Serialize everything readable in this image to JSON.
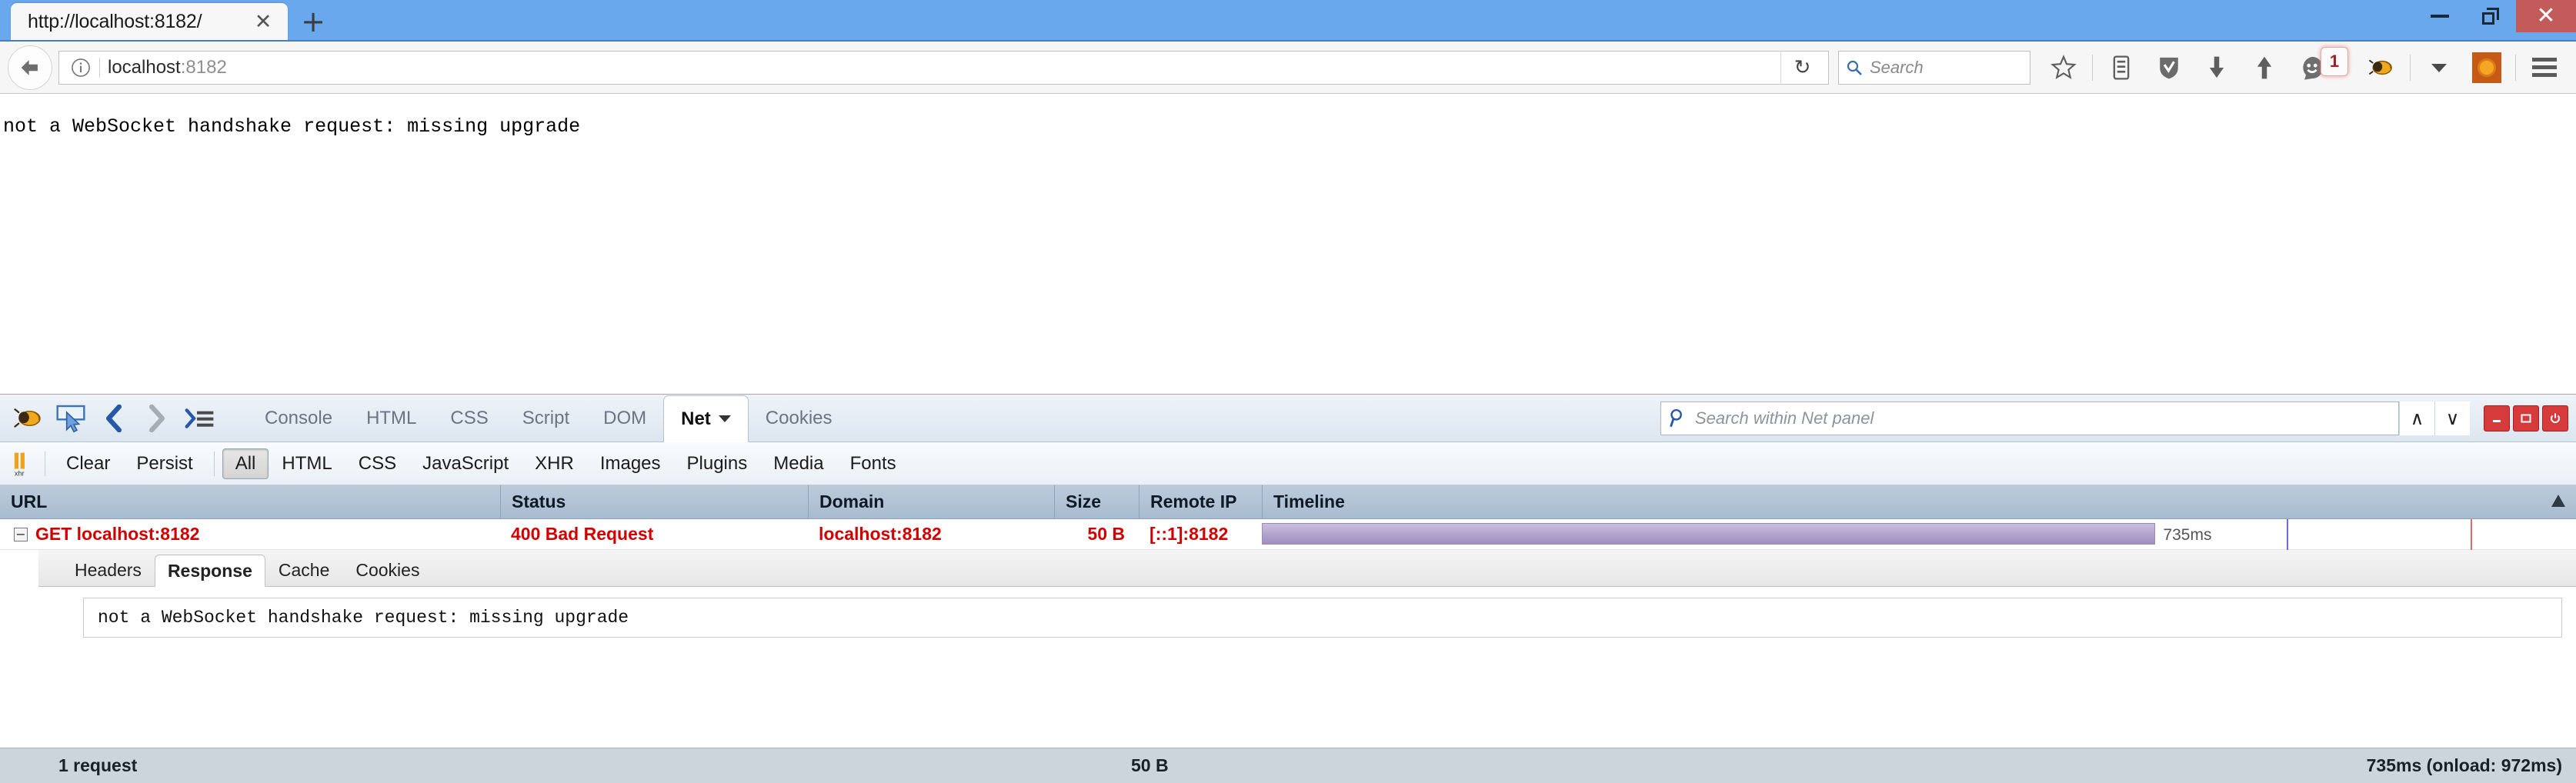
{
  "browser": {
    "tab": {
      "title": "http://localhost:8182/",
      "close_label": "✕"
    },
    "newtab_label": "+",
    "window_controls": {
      "minimize": "minimize-icon",
      "restore": "restore-icon",
      "close": "✕"
    },
    "nav": {
      "back_label": "←",
      "info_label": "i",
      "url_host": "localhost",
      "url_port": ":8182",
      "reload_label": "↻",
      "search_placeholder": "Search"
    },
    "toolbar_icons": [
      {
        "name": "bookmark-star-icon",
        "glyph": "☆"
      },
      {
        "name": "reader-list-icon",
        "glyph": "☰"
      },
      {
        "name": "shield-icon",
        "glyph": "✔"
      },
      {
        "name": "download-icon",
        "glyph": "↓"
      },
      {
        "name": "home-up-icon",
        "glyph": "↑"
      },
      {
        "name": "smiley-feedback-icon",
        "glyph": "☺"
      },
      {
        "name": "firebug-icon",
        "glyph": "🐞"
      },
      {
        "name": "dropdown-caret-icon",
        "glyph": "▾"
      },
      {
        "name": "addon-orange-icon",
        "glyph": "☀"
      },
      {
        "name": "menu-hamburger-icon",
        "glyph": "☰"
      }
    ],
    "notification_badge": "1"
  },
  "page": {
    "body_text": "not a WebSocket handshake request: missing upgrade"
  },
  "firebug": {
    "toolbar_icons": [
      {
        "name": "firebug-bug-icon"
      },
      {
        "name": "inspector-icon"
      },
      {
        "name": "back-chevron-icon",
        "glyph": "‹"
      },
      {
        "name": "forward-chevron-icon",
        "glyph": "›"
      },
      {
        "name": "command-line-icon",
        "glyph": "≫"
      }
    ],
    "panels": [
      {
        "label": "Console",
        "active": false
      },
      {
        "label": "HTML",
        "active": false
      },
      {
        "label": "CSS",
        "active": false
      },
      {
        "label": "Script",
        "active": false
      },
      {
        "label": "DOM",
        "active": false
      },
      {
        "label": "Net",
        "active": true
      },
      {
        "label": "Cookies",
        "active": false
      }
    ],
    "search": {
      "placeholder": "Search within Net panel",
      "prev_label": "∧",
      "next_label": "∨"
    },
    "window_buttons": [
      {
        "name": "fb-minimize-button",
        "glyph": "▬"
      },
      {
        "name": "fb-detach-button",
        "glyph": "❐"
      },
      {
        "name": "fb-close-button",
        "glyph": "⏻"
      }
    ],
    "net_toolbar": {
      "xhr_icon": "xhr-icon",
      "clear_label": "Clear",
      "persist_label": "Persist",
      "filters": [
        {
          "label": "All",
          "active": true
        },
        {
          "label": "HTML",
          "active": false
        },
        {
          "label": "CSS",
          "active": false
        },
        {
          "label": "JavaScript",
          "active": false
        },
        {
          "label": "XHR",
          "active": false
        },
        {
          "label": "Images",
          "active": false
        },
        {
          "label": "Plugins",
          "active": false
        },
        {
          "label": "Media",
          "active": false
        },
        {
          "label": "Fonts",
          "active": false
        }
      ]
    },
    "net_table": {
      "columns": [
        "URL",
        "Status",
        "Domain",
        "Size",
        "Remote IP",
        "Timeline"
      ],
      "rows": [
        {
          "twisty": "−",
          "url": "GET localhost:8182",
          "status": "400 Bad Request",
          "domain": "localhost:8182",
          "size": "50 B",
          "remote_ip": "[::1]:8182",
          "timeline_label": "735ms",
          "timeline_bar_pct": 68
        }
      ]
    },
    "detail_tabs": [
      {
        "label": "Headers",
        "active": false
      },
      {
        "label": "Response",
        "active": true
      },
      {
        "label": "Cache",
        "active": false
      },
      {
        "label": "Cookies",
        "active": false
      }
    ],
    "response_body": "not a WebSocket handshake request: missing upgrade",
    "statusbar": {
      "request_count": "1 request",
      "total_size": "50 B",
      "timing": "735ms (onload: 972ms)"
    }
  }
}
